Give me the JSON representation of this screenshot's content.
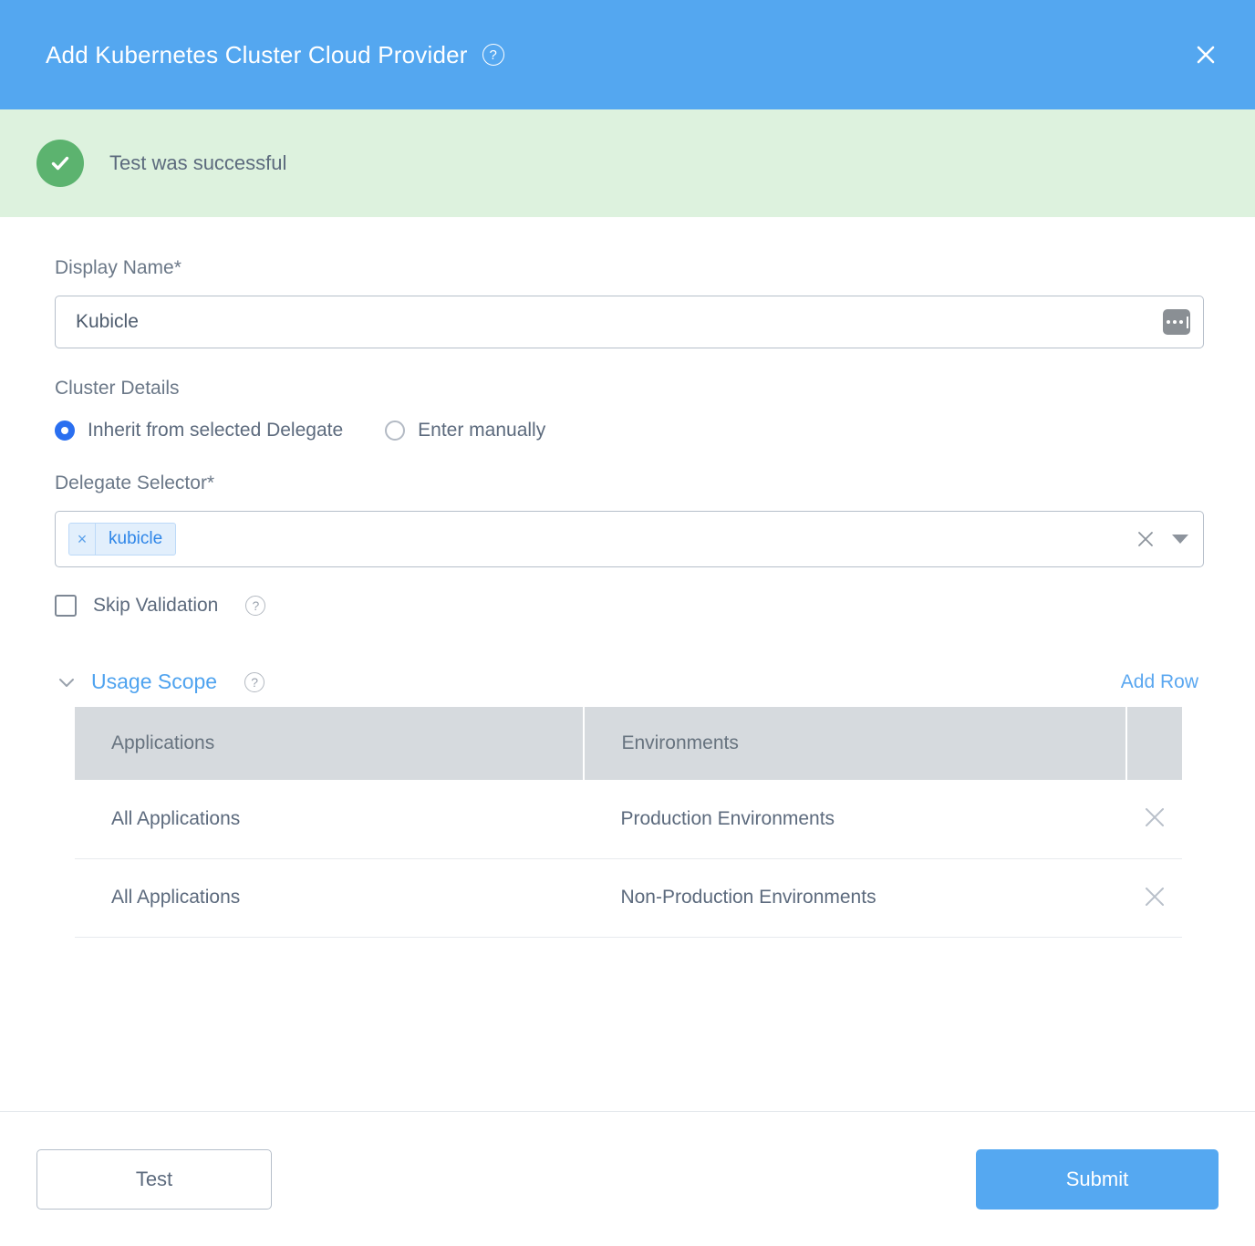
{
  "header": {
    "title": "Add Kubernetes Cluster Cloud Provider",
    "help_icon": "question-mark-circle-icon",
    "close_icon": "close-icon",
    "bg_color": "#54a7f0"
  },
  "banner": {
    "icon": "check-circle-icon",
    "message": "Test was successful",
    "bg_color": "#ddf2de",
    "icon_color": "#5cb36f"
  },
  "display_name": {
    "label": "Display Name*",
    "value": "Kubicle",
    "placeholder": "",
    "trailing_icon": "variable-expression-icon"
  },
  "cluster_details": {
    "label": "Cluster Details",
    "options": [
      {
        "label": "Inherit from selected Delegate",
        "selected": true
      },
      {
        "label": "Enter manually",
        "selected": false
      }
    ],
    "selected_color": "#2a6ff0"
  },
  "delegate_selector": {
    "label": "Delegate Selector*",
    "chips": [
      {
        "label": "kubicle",
        "remove_icon": "chip-remove-icon"
      }
    ],
    "clear_icon": "clear-icon",
    "dropdown_icon": "caret-down-icon",
    "placeholder": ""
  },
  "skip_validation": {
    "label": "Skip Validation",
    "checked": false,
    "help_icon": "question-mark-circle-icon"
  },
  "usage_scope": {
    "title": "Usage Scope",
    "expanded": true,
    "collapse_icon": "chevron-down-icon",
    "help_icon": "question-mark-circle-icon",
    "add_row_label": "Add Row",
    "link_color": "#4fa3ef",
    "table": {
      "columns": [
        "Applications",
        "Environments",
        ""
      ],
      "rows": [
        {
          "applications": "All Applications",
          "environments": "Production Environments",
          "remove_icon": "row-remove-icon"
        },
        {
          "applications": "All Applications",
          "environments": "Non-Production Environments",
          "remove_icon": "row-remove-icon"
        }
      ]
    }
  },
  "footer": {
    "test_label": "Test",
    "submit_label": "Submit",
    "submit_color": "#55a8f1"
  }
}
